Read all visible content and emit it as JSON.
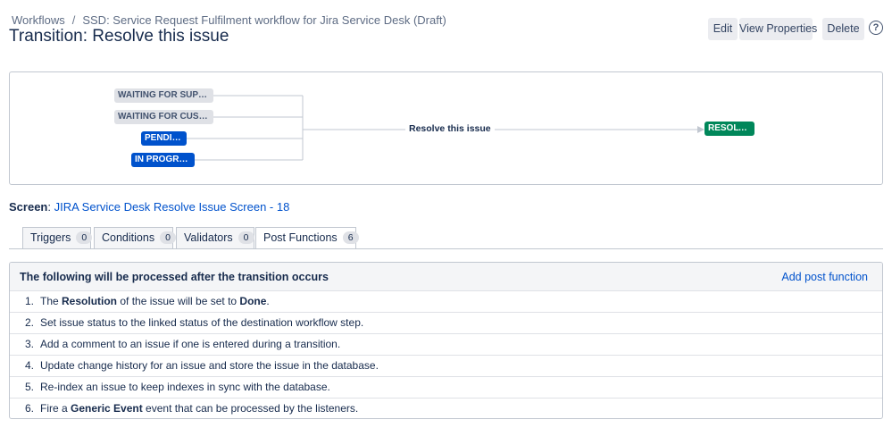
{
  "breadcrumb": {
    "root": "Workflows",
    "separator": "/",
    "workflow": "SSD: Service Request Fulfilment workflow for Jira Service Desk (Draft)"
  },
  "title": "Transition: Resolve this issue",
  "actions": {
    "edit": "Edit",
    "view_properties": "View Properties",
    "delete": "Delete",
    "help_glyph": "?"
  },
  "diagram": {
    "from_statuses": [
      {
        "label": "WAITING FOR SUPP...",
        "category": "grey"
      },
      {
        "label": "WAITING FOR CUST...",
        "category": "grey"
      },
      {
        "label": "PENDING",
        "category": "blue"
      },
      {
        "label": "IN PROGRESS",
        "category": "blue"
      }
    ],
    "transition_label": "Resolve this issue",
    "to_status": {
      "label": "RESOLVED",
      "category": "green"
    },
    "colors": {
      "grey": "#dfe1e6",
      "blue": "#0052cc",
      "green": "#00875a",
      "line": "#c1c7d0"
    }
  },
  "screen": {
    "label": "Screen",
    "value": "JIRA Service Desk Resolve Issue Screen - 18"
  },
  "tabs": [
    {
      "label": "Triggers",
      "count": "0",
      "active": false
    },
    {
      "label": "Conditions",
      "count": "0",
      "active": false
    },
    {
      "label": "Validators",
      "count": "0",
      "active": false
    },
    {
      "label": "Post Functions",
      "count": "6",
      "active": true
    }
  ],
  "post_functions": {
    "header": "The following will be processed after the transition occurs",
    "add_link": "Add post function",
    "items": [
      {
        "num": "1.",
        "parts": [
          {
            "t": "The "
          },
          {
            "t": "Resolution",
            "b": true
          },
          {
            "t": " of the issue will be set to "
          },
          {
            "t": "Done",
            "b": true
          },
          {
            "t": "."
          }
        ]
      },
      {
        "num": "2.",
        "parts": [
          {
            "t": "Set issue status to the linked status of the destination workflow step."
          }
        ]
      },
      {
        "num": "3.",
        "parts": [
          {
            "t": "Add a comment to an issue if one is entered during a transition."
          }
        ]
      },
      {
        "num": "4.",
        "parts": [
          {
            "t": "Update change history for an issue and store the issue in the database."
          }
        ]
      },
      {
        "num": "5.",
        "parts": [
          {
            "t": "Re-index an issue to keep indexes in sync with the database."
          }
        ]
      },
      {
        "num": "6.",
        "parts": [
          {
            "t": "Fire a "
          },
          {
            "t": "Generic Event",
            "b": true
          },
          {
            "t": " event that can be processed by the listeners."
          }
        ]
      }
    ]
  }
}
